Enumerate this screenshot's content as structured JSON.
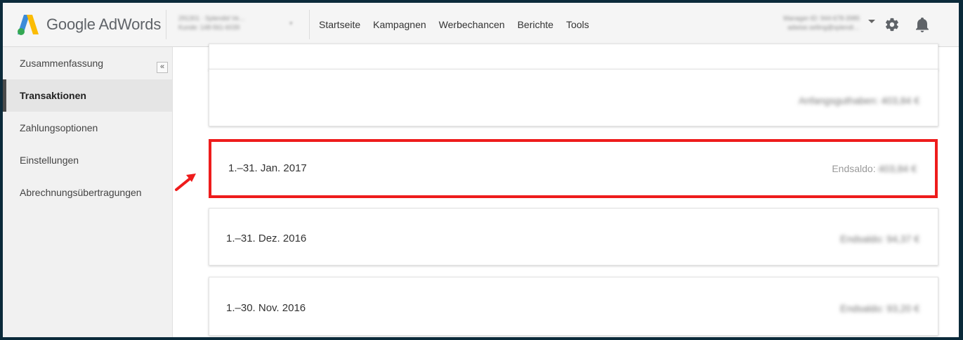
{
  "app": {
    "logo_text": "Google AdWords",
    "account_line1": "291301 · Splendid Ve…",
    "account_line2": "Kunde: 148-561-6039",
    "manager_line1": "Manager-ID: 944-678-3985",
    "manager_line2": "adwise.selling@splendi…"
  },
  "nav": {
    "items": [
      "Startseite",
      "Kampagnen",
      "Werbechancen",
      "Berichte",
      "Tools"
    ]
  },
  "sidebar": {
    "collapse_label": "«",
    "items": [
      {
        "label": "Zusammenfassung",
        "active": false
      },
      {
        "label": "Transaktionen",
        "active": true
      },
      {
        "label": "Zahlungsoptionen",
        "active": false
      },
      {
        "label": "Einstellungen",
        "active": false
      },
      {
        "label": "Abrechnungsübertragungen",
        "active": false
      }
    ]
  },
  "main": {
    "starting_balance": "Anfangsguthaben: 403,84 €",
    "statements": [
      {
        "period": "1.–31. Jan. 2017",
        "balance_label": "Endsaldo:",
        "balance_value": "403,84 €"
      },
      {
        "period": "1.–31. Dez. 2016",
        "balance_label": "Endsaldo: 94,37 €",
        "balance_value": ""
      },
      {
        "period": "1.–30. Nov. 2016",
        "balance_label": "Endsaldo: 93,20 €",
        "balance_value": ""
      }
    ]
  },
  "colors": {
    "highlight": "#ee1c1c",
    "frame": "#0b2a3a"
  }
}
